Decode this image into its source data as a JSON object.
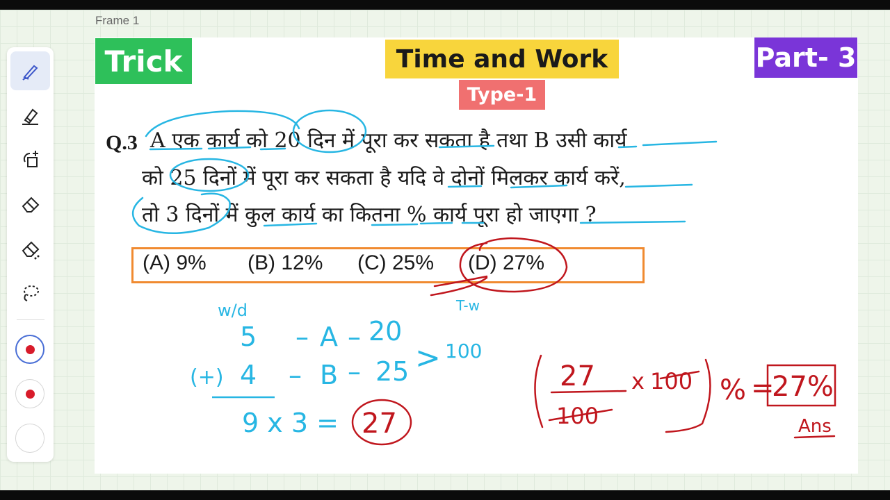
{
  "frame_label": "Frame 1",
  "toolbar": {
    "tools": [
      "pen-icon",
      "highlighter-icon",
      "shape-add-icon",
      "eraser-icon",
      "stroke-eraser-icon",
      "lasso-icon"
    ],
    "colors": [
      {
        "name": "red",
        "hex": "#d81b2a",
        "selected": true
      },
      {
        "name": "red",
        "hex": "#d81b2a",
        "selected": false
      },
      {
        "name": "white",
        "hex": "#ffffff",
        "selected": false
      }
    ]
  },
  "slide": {
    "trick_label": "Trick",
    "title": "Time and Work",
    "type_label": "Type-1",
    "part_label": "Part- 3",
    "question": {
      "number": "Q.3",
      "lines": [
        "A एक कार्य को 20 दिन में पूरा कर सकता है तथा B उसी कार्य",
        "को 25 दिनों में पूरा कर सकता है यदि वे दोनों मिलकर कार्य करें,",
        "तो 3 दिनों में कुल कार्य का कितना % कार्य पूरा हो जाएगा ?"
      ]
    },
    "options": [
      "(A)  9%",
      "(B) 12%",
      "(C) 25%",
      "(D) 27%"
    ]
  },
  "annotations": {
    "wd_label": "w/d",
    "tw_label": "T-w",
    "rows": [
      {
        "eff": "5",
        "name": "A",
        "days": "20"
      },
      {
        "eff": "4",
        "name": "B",
        "days": "25"
      }
    ],
    "plus_sign": "(+)",
    "total_work": "100",
    "product": "9 x 3 =",
    "result": "27",
    "fraction_num": "27",
    "fraction_den": "100",
    "times": "x",
    "hundred": "100",
    "percent": "%",
    "equals": "=",
    "answer": "27%",
    "ans_label": "Ans",
    "colors": {
      "blue": "#27b6e3",
      "red": "#c0161d"
    }
  }
}
